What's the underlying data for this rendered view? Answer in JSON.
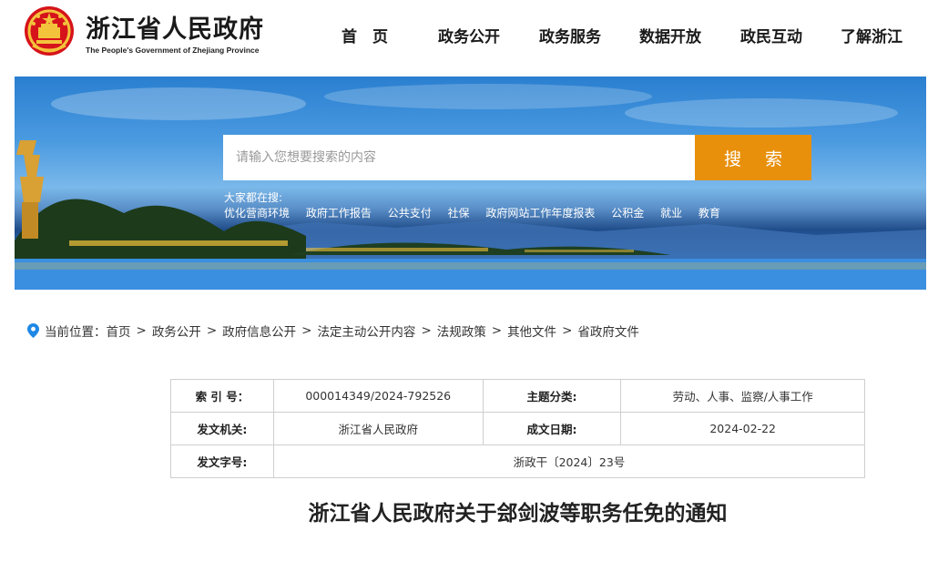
{
  "header": {
    "site_title": "浙江省人民政府",
    "site_subtitle": "The People's Government of Zhejiang Province",
    "nav": [
      "首　页",
      "政务公开",
      "政务服务",
      "数据开放",
      "政民互动",
      "了解浙江"
    ]
  },
  "banner": {
    "search_placeholder": "请输入您想要搜索的内容",
    "search_button": "搜 索",
    "hot_label": "大家都在搜:",
    "hot_links": [
      "优化营商环境",
      "政府工作报告",
      "公共支付",
      "社保",
      "政府网站工作年度报表",
      "公积金",
      "就业",
      "教育"
    ]
  },
  "breadcrumb": {
    "label": "当前位置：",
    "items": [
      "首页",
      "政务公开",
      "政府信息公开",
      "法定主动公开内容",
      "法规政策",
      "其他文件",
      "省政府文件"
    ]
  },
  "meta": {
    "index_label": "索 引 号：",
    "index_value": "000014349/2024-792526",
    "topic_label": "主题分类:",
    "topic_value": "劳动、人事、监察/人事工作",
    "issuer_label": "发文机关:",
    "issuer_value": "浙江省人民政府",
    "date_label": "成文日期:",
    "date_value": "2024-02-22",
    "docno_label": "发文字号:",
    "docno_value": "浙政干〔2024〕23号"
  },
  "document": {
    "title": "浙江省人民政府关于郐剑波等职务任免的通知"
  },
  "colors": {
    "accent": "#e8900c",
    "emblem_red": "#d6131a",
    "emblem_gold": "#f3c33c",
    "breadcrumb_pin": "#1e88e5"
  }
}
